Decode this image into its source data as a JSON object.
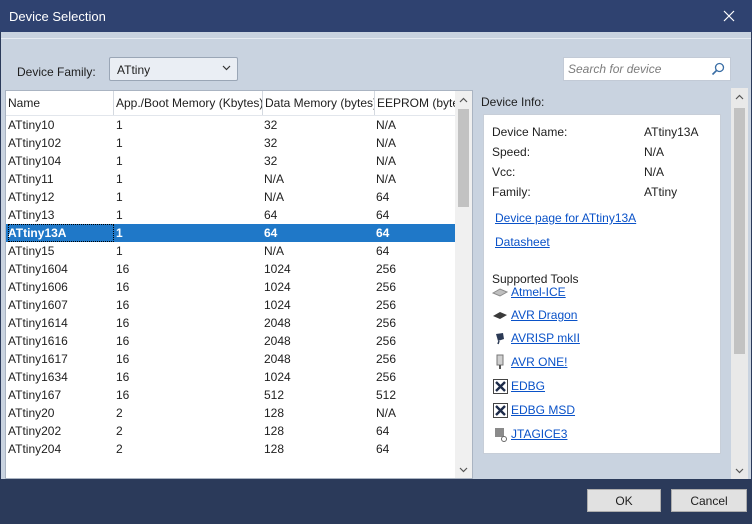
{
  "window": {
    "title": "Device Selection"
  },
  "toolbar": {
    "family_label": "Device Family:",
    "family_value": "ATtiny",
    "search_placeholder": "Search for device"
  },
  "table": {
    "headers": [
      "Name",
      "App./Boot Memory (Kbytes)",
      "Data Memory (bytes)",
      "EEPROM (bytes"
    ],
    "selected_index": 6,
    "rows": [
      [
        "ATtiny10",
        "1",
        "32",
        "N/A"
      ],
      [
        "ATtiny102",
        "1",
        "32",
        "N/A"
      ],
      [
        "ATtiny104",
        "1",
        "32",
        "N/A"
      ],
      [
        "ATtiny11",
        "1",
        "N/A",
        "N/A"
      ],
      [
        "ATtiny12",
        "1",
        "N/A",
        "64"
      ],
      [
        "ATtiny13",
        "1",
        "64",
        "64"
      ],
      [
        "ATtiny13A",
        "1",
        "64",
        "64"
      ],
      [
        "ATtiny15",
        "1",
        "N/A",
        "64"
      ],
      [
        "ATtiny1604",
        "16",
        "1024",
        "256"
      ],
      [
        "ATtiny1606",
        "16",
        "1024",
        "256"
      ],
      [
        "ATtiny1607",
        "16",
        "1024",
        "256"
      ],
      [
        "ATtiny1614",
        "16",
        "2048",
        "256"
      ],
      [
        "ATtiny1616",
        "16",
        "2048",
        "256"
      ],
      [
        "ATtiny1617",
        "16",
        "2048",
        "256"
      ],
      [
        "ATtiny1634",
        "16",
        "1024",
        "256"
      ],
      [
        "ATtiny167",
        "16",
        "512",
        "512"
      ],
      [
        "ATtiny20",
        "2",
        "128",
        "N/A"
      ],
      [
        "ATtiny202",
        "2",
        "128",
        "64"
      ],
      [
        "ATtiny204",
        "2",
        "128",
        "64"
      ]
    ]
  },
  "info": {
    "title": "Device Info:",
    "fields": [
      {
        "label": "Device Name:",
        "value": "ATtiny13A"
      },
      {
        "label": "Speed:",
        "value": "N/A"
      },
      {
        "label": "Vcc:",
        "value": "N/A"
      },
      {
        "label": "Family:",
        "value": "ATtiny"
      }
    ],
    "device_page_link": "Device page for ATtiny13A",
    "datasheet_link": "Datasheet",
    "tools_heading": "Supported Tools",
    "tools": [
      {
        "label": "Atmel-ICE",
        "icon": "atmel-ice-icon"
      },
      {
        "label": "AVR Dragon",
        "icon": "avr-dragon-icon"
      },
      {
        "label": "AVRISP mkII",
        "icon": "avrisp-icon"
      },
      {
        "label": "AVR ONE!",
        "icon": "avr-one-icon"
      },
      {
        "label": "EDBG",
        "icon": "edbg-icon"
      },
      {
        "label": "EDBG MSD",
        "icon": "edbg-msd-icon"
      },
      {
        "label": "JTAGICE3",
        "icon": "jtagice3-icon"
      }
    ]
  },
  "buttons": {
    "ok": "OK",
    "cancel": "Cancel"
  },
  "colors": {
    "titlebar": "#2f4270",
    "selection": "#1f78c8",
    "link": "#0a52c8"
  }
}
